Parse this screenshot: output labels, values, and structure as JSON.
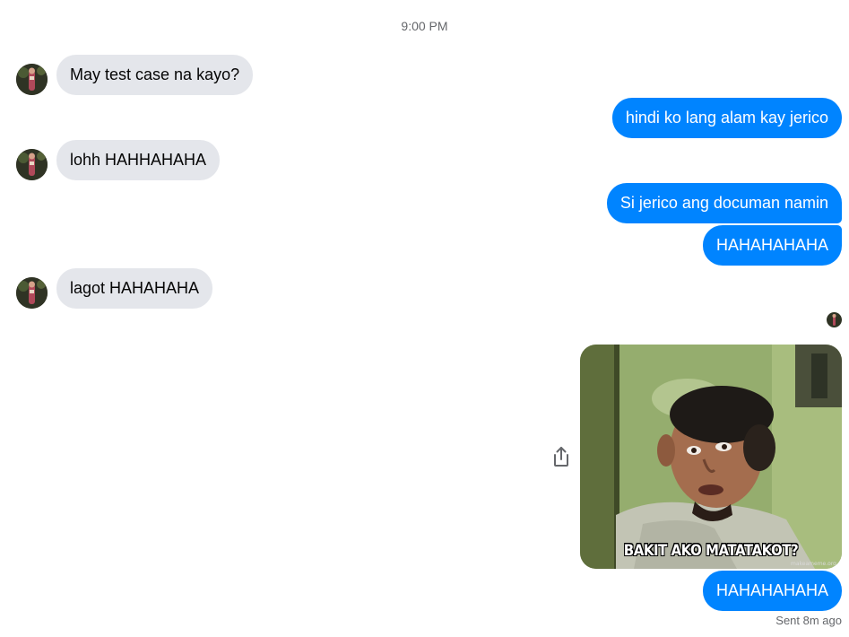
{
  "conversation": {
    "timestamp": "9:00 PM",
    "messages": [
      {
        "direction": "in",
        "text": "May test case na kayo?"
      },
      {
        "direction": "out",
        "text": "hindi ko lang alam kay jerico"
      },
      {
        "direction": "in",
        "text": "lohh HAHHAHAHA"
      },
      {
        "direction": "out",
        "text": "Si jerico ang documan namin"
      },
      {
        "direction": "out",
        "text": "HAHAHAHAHA"
      },
      {
        "direction": "in",
        "text": "lagot HAHAHAHA"
      },
      {
        "direction": "out",
        "type": "image",
        "caption": "BAKIT AKO MATATAKOT?",
        "watermark": "makeameme.org"
      },
      {
        "direction": "out",
        "text": "HAHAHAHAHA"
      }
    ],
    "status": "Sent 8m ago"
  },
  "colors": {
    "outgoing_bubble": "#0084ff",
    "incoming_bubble": "#e4e6eb",
    "meta_text": "#65676b"
  },
  "icons": {
    "share": "share-icon",
    "avatar": "contact-avatar",
    "seen": "seen-avatar"
  }
}
